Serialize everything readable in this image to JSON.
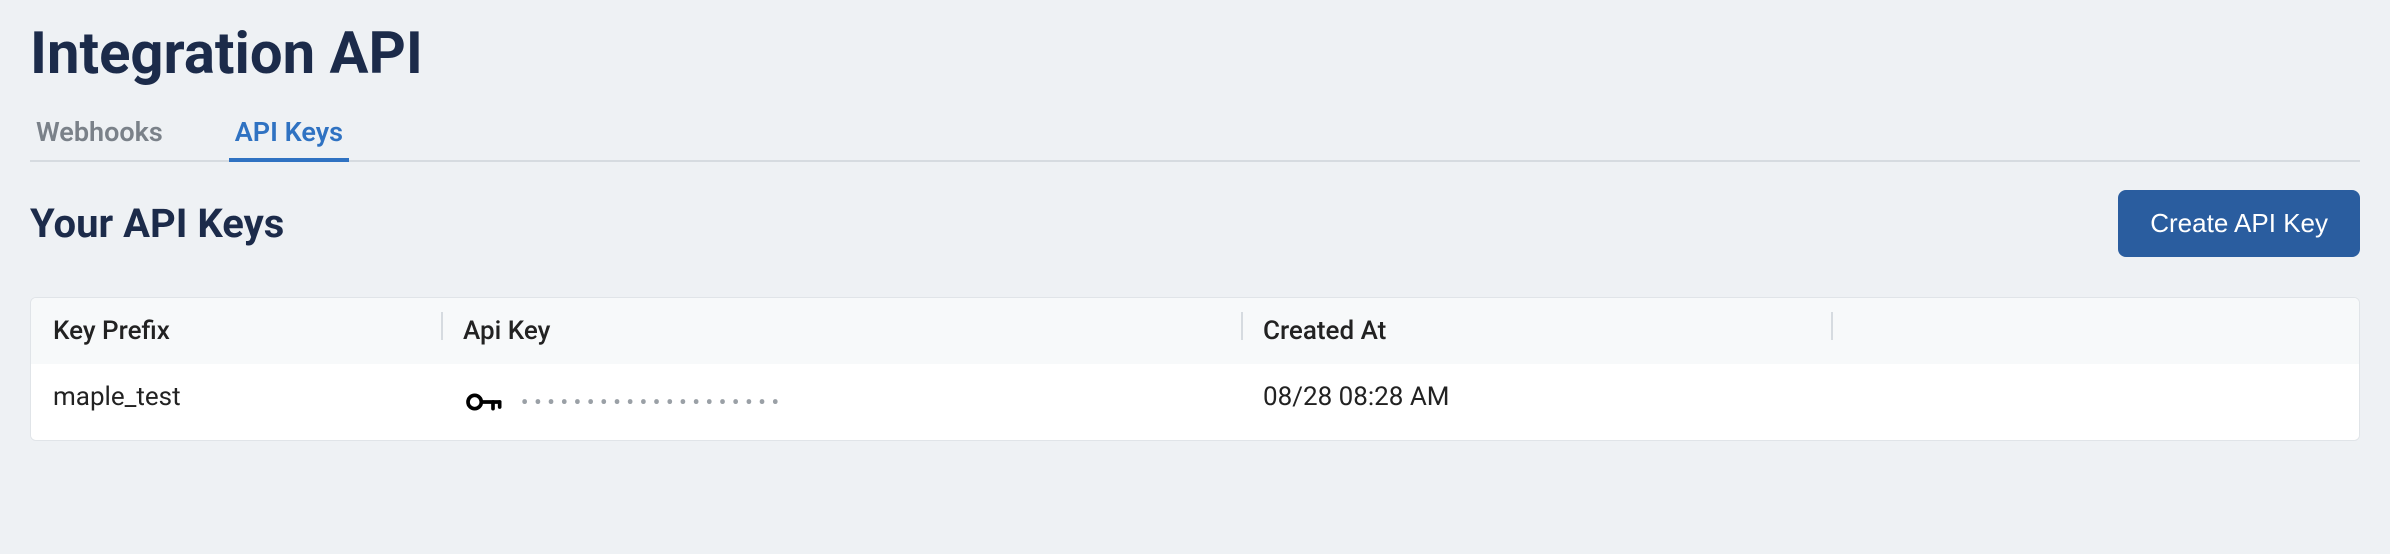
{
  "page": {
    "title": "Integration API"
  },
  "tabs": {
    "items": [
      {
        "label": "Webhooks",
        "active": false
      },
      {
        "label": "API Keys",
        "active": true
      }
    ]
  },
  "section": {
    "title": "Your API Keys",
    "create_button": "Create API Key"
  },
  "table": {
    "columns": {
      "prefix": "Key Prefix",
      "apikey": "Api Key",
      "created": "Created At"
    },
    "rows": [
      {
        "prefix": "maple_test",
        "key_masked": "••••••••••••••••••••",
        "created": "08/28 08:28 AM"
      }
    ]
  }
}
